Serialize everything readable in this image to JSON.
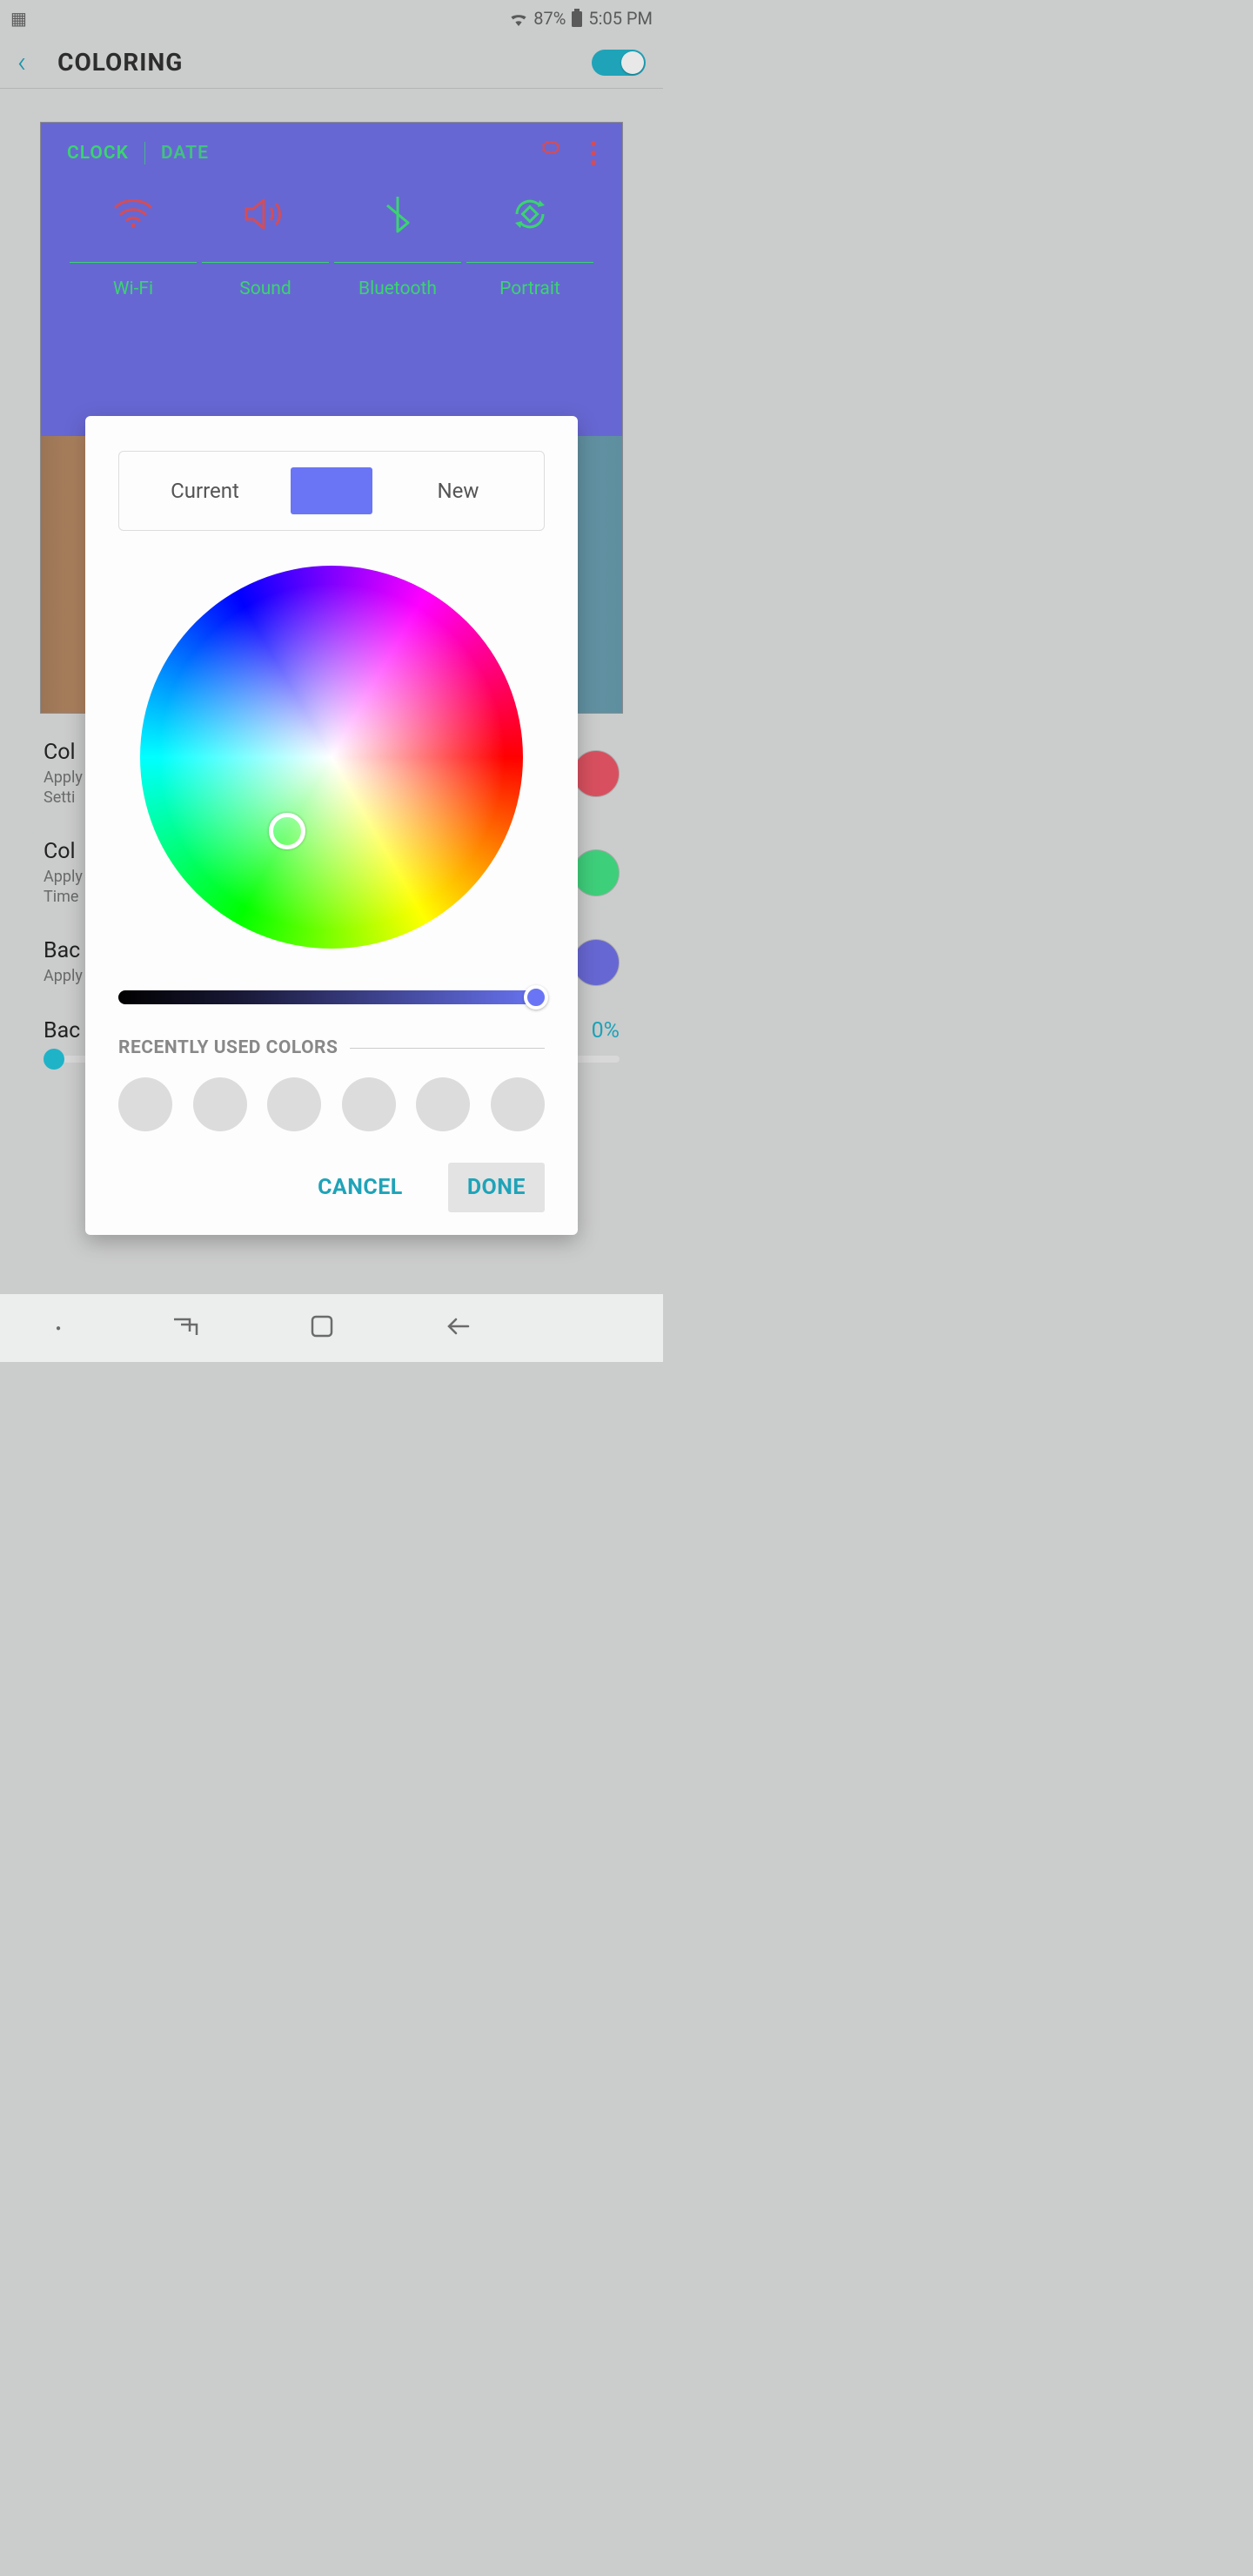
{
  "status": {
    "battery_pct": "87%",
    "time": "5:05 PM"
  },
  "header": {
    "title": "COLORING",
    "toggle_on": true
  },
  "preview": {
    "tabs": {
      "clock": "CLOCK",
      "date": "DATE"
    },
    "tiles": [
      {
        "label": "Wi-Fi"
      },
      {
        "label": "Sound"
      },
      {
        "label": "Bluetooth"
      },
      {
        "label": "Portrait"
      }
    ]
  },
  "settings": {
    "item1": {
      "title": "Col",
      "sub1": "Apply",
      "sub2": "Setti"
    },
    "item2": {
      "title": "Col",
      "sub1": "Apply",
      "sub2": "Time"
    },
    "item3": {
      "title": "Bac",
      "sub1": "Apply"
    },
    "dim": {
      "title": "Bac",
      "value": "0%"
    }
  },
  "dialog": {
    "current_label": "Current",
    "new_label": "New",
    "swatch_color": "#6a75f5",
    "recent_title": "RECENTLY USED COLORS",
    "cancel": "CANCEL",
    "done": "DONE"
  }
}
